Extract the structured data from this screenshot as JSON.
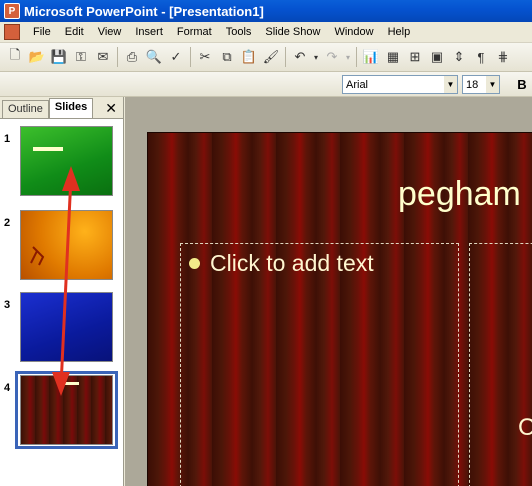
{
  "window": {
    "title": "Microsoft PowerPoint - [Presentation1]"
  },
  "menu": [
    "File",
    "Edit",
    "View",
    "Insert",
    "Format",
    "Tools",
    "Slide Show",
    "Window",
    "Help"
  ],
  "format_toolbar": {
    "font": "Arial",
    "size": "18",
    "bold_label": "B"
  },
  "pane": {
    "tab_outline": "Outline",
    "tab_slides": "Slides",
    "close": "✕"
  },
  "slides": [
    {
      "number": "1",
      "theme": "green"
    },
    {
      "number": "2",
      "theme": "orange"
    },
    {
      "number": "3",
      "theme": "blue"
    },
    {
      "number": "4",
      "theme": "dark-red",
      "selected": true
    }
  ],
  "slide": {
    "title": "pegham",
    "bullet_placeholder": "Click to add text",
    "right_fragment": "C"
  },
  "annotation": {
    "arrow_color": "#e03020"
  }
}
